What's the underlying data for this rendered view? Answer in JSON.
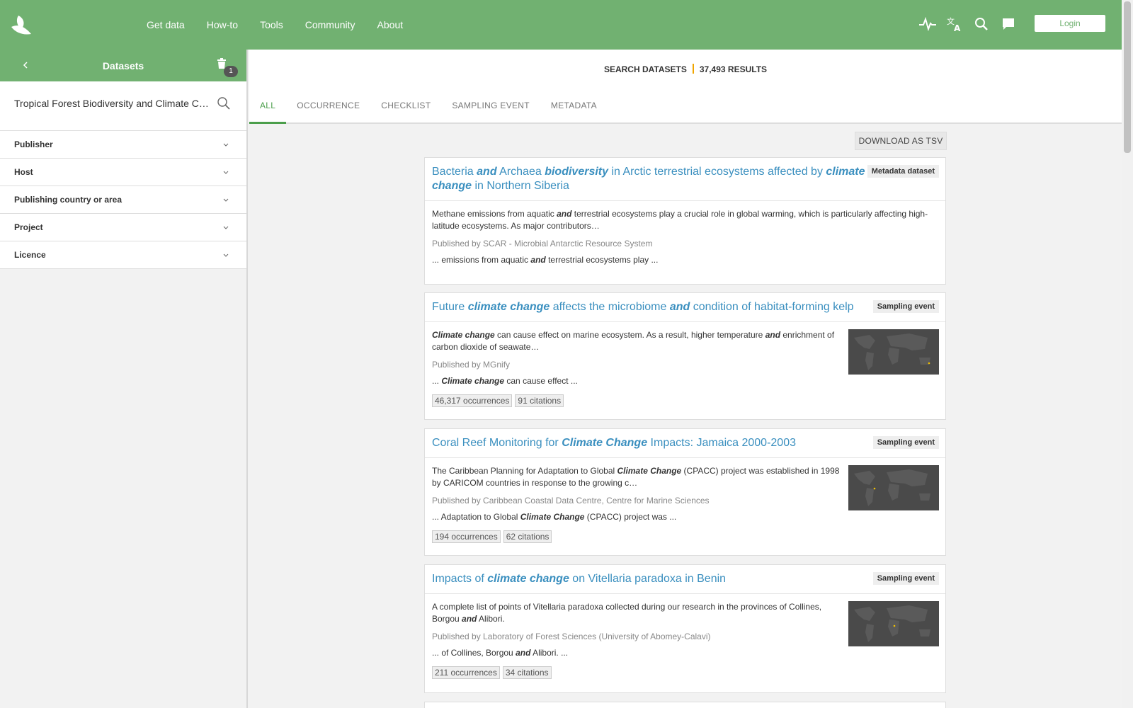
{
  "nav": {
    "links": [
      "Get data",
      "How-to",
      "Tools",
      "Community",
      "About"
    ],
    "icons": [
      "activity-icon",
      "translate-icon",
      "search-icon",
      "feedback-icon"
    ],
    "login_label": "Login",
    "brand_color": "#71b171"
  },
  "sidebar": {
    "title": "Datasets",
    "badge_count": "1",
    "search_value": "Tropical Forest Biodiversity and Climate Change",
    "filters": [
      "Publisher",
      "Host",
      "Publishing country or area",
      "Project",
      "Licence"
    ]
  },
  "main": {
    "search_label": "SEARCH DATASETS",
    "results_label": "37,493 RESULTS",
    "tabs": [
      "ALL",
      "OCCURRENCE",
      "CHECKLIST",
      "SAMPLING EVENT",
      "METADATA"
    ],
    "active_tab": "ALL",
    "download_label": "DOWNLOAD AS TSV",
    "accent_color": "#4b9e4b",
    "link_color": "#3a8fbf"
  },
  "results": [
    {
      "title_parts": [
        "Bacteria ",
        "and",
        " Archaea ",
        "biodiversity",
        " in Arctic terrestrial ecosystems affected by ",
        "climate change",
        " in Northern Siberia"
      ],
      "type": "Metadata dataset",
      "desc_parts": [
        "Methane emissions from aquatic ",
        "and",
        " terrestrial ecosystems play a crucial role in global warming, which is particularly affecting high-latitude ecosystems. As major contributors…"
      ],
      "publisher": "Published by SCAR - Microbial Antarctic Resource System",
      "highlight_parts": [
        "... emissions from aquatic ",
        "and",
        " terrestrial ecosystems play ..."
      ],
      "occurrences": "",
      "citations": ""
    },
    {
      "title_parts": [
        "Future ",
        "climate change",
        " affects the microbiome ",
        "and",
        " condition of habitat-forming kelp"
      ],
      "type": "Sampling event",
      "desc_parts": [
        "",
        "Climate change",
        " can cause effect on marine ecosystem. As a result, higher temperature ",
        "and",
        " enrichment of carbon dioxide of seawate…"
      ],
      "publisher": "Published by MGnify",
      "highlight_parts": [
        "... ",
        "Climate change",
        " can cause effect ..."
      ],
      "occurrences": "46,317 occurrences",
      "citations": "91 citations"
    },
    {
      "title_parts": [
        "Coral Reef Monitoring for ",
        "Climate Change",
        " Impacts: Jamaica 2000-2003"
      ],
      "type": "Sampling event",
      "desc_parts": [
        "The Caribbean Planning for Adaptation to Global ",
        "Climate Change",
        " (CPACC) project was established in 1998 by CARICOM countries in response to the growing c…"
      ],
      "publisher": "Published by Caribbean Coastal Data Centre, Centre for Marine Sciences",
      "highlight_parts": [
        "... Adaptation to Global ",
        "Climate Change",
        " (CPACC) project was ..."
      ],
      "occurrences": "194 occurrences",
      "citations": "62 citations"
    },
    {
      "title_parts": [
        "Impacts of ",
        "climate change",
        " on Vitellaria paradoxa in Benin"
      ],
      "type": "Sampling event",
      "desc_parts": [
        "A complete list of points of Vitellaria paradoxa collected during our research in the provinces of Collines, Borgou ",
        "and",
        " Alibori."
      ],
      "publisher": "Published by Laboratory of Forest Sciences (University of Abomey-Calavi)",
      "highlight_parts": [
        "... of Collines, Borgou ",
        "and",
        " Alibori. ..."
      ],
      "occurrences": "211 occurrences",
      "citations": "34 citations"
    }
  ]
}
